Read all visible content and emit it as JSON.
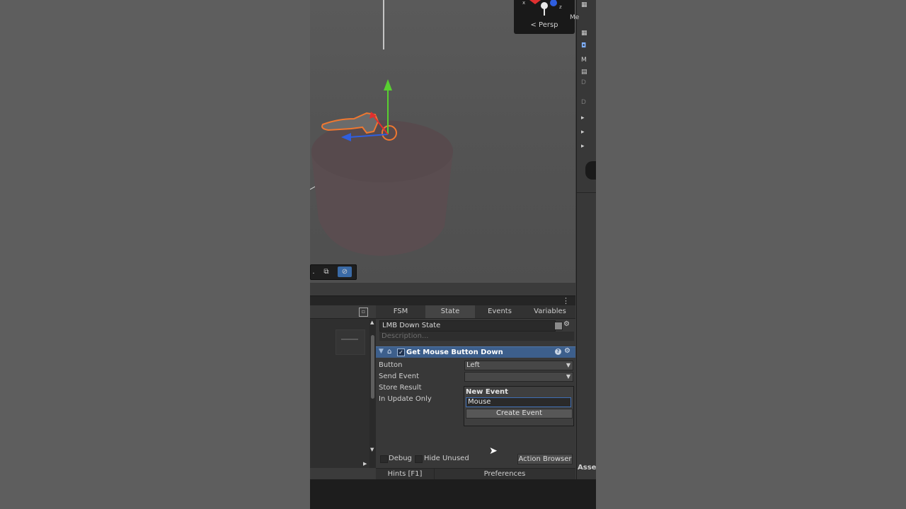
{
  "scene": {
    "persp_label": "< Persp",
    "gizmo_axes": [
      "x",
      "y",
      "z"
    ]
  },
  "inspector_strip": {
    "rows": [
      "Me",
      "M",
      "D",
      "D"
    ]
  },
  "fsm": {
    "tabs": [
      "FSM",
      "State",
      "Events",
      "Variables"
    ],
    "active_tab": "State",
    "state_name": "LMB Down State",
    "description_placeholder": "Description...",
    "action": {
      "title": "Get Mouse Button Down",
      "enabled": true,
      "properties": [
        {
          "label": "Button",
          "value": "Left",
          "type": "dropdown"
        },
        {
          "label": "Send Event",
          "value": "",
          "type": "dropdown"
        },
        {
          "label": "Store Result",
          "value": "",
          "type": "field"
        },
        {
          "label": "In Update Only",
          "value": "",
          "type": "toggle"
        }
      ]
    },
    "popup": {
      "title": "New Event",
      "input_value": "Mouse",
      "button_label": "Create Event"
    },
    "bottom": {
      "debug_label": "Debug",
      "hide_unused_label": "Hide Unused",
      "action_browser_label": "Action Browser"
    },
    "hints_label": "Hints [F1]",
    "preferences_label": "Preferences"
  },
  "side_tab_label": "Asse"
}
